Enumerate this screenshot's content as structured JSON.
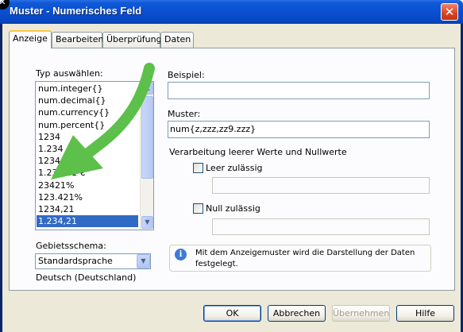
{
  "window": {
    "title": "Muster - Numerisches Feld",
    "close_glyph": "✕"
  },
  "tabs": [
    {
      "label": "Anzeige"
    },
    {
      "label": "Bearbeiten"
    },
    {
      "label": "Überprüfung"
    },
    {
      "label": "Daten"
    }
  ],
  "left": {
    "type_label": "Typ auswählen:",
    "types": [
      "num.integer{}",
      "num.decimal{}",
      "num.currency{}",
      "num.percent{}",
      "1234",
      "1.234",
      "1234,21 €",
      "1.234,21 €",
      "23421%",
      "123.421%",
      "1234,21",
      "1.234,21"
    ],
    "selected_type": "1.234,21",
    "region_label": "Gebietsschema:",
    "region_value": "Standardsprache",
    "region_locale": "Deutsch (Deutschland)"
  },
  "right": {
    "example_label": "Beispiel:",
    "example_value": "",
    "pattern_label": "Muster:",
    "pattern_value": "num{z,zzz,zz9.zzz}",
    "group_label": "Verarbeitung leerer Werte und Nullwerte",
    "empty_allowed_label": "Leer zulässig",
    "empty_allowed_checked": false,
    "empty_value": "",
    "zero_allowed_label": "Null zulässig",
    "zero_allowed_checked": false,
    "zero_value": "",
    "info_text": "Mit dem Anzeigemuster wird die Darstellung der Daten festgelegt."
  },
  "buttons": {
    "ok": "OK",
    "cancel": "Abbrechen",
    "apply": "Übernehmen",
    "help": "Hilfe"
  },
  "colors": {
    "selection": "#316ac5",
    "annotation_arrow": "#5cc04a",
    "titlebar": "#0a4fd0"
  },
  "icons": {
    "info": "info-icon",
    "close": "close-icon"
  }
}
